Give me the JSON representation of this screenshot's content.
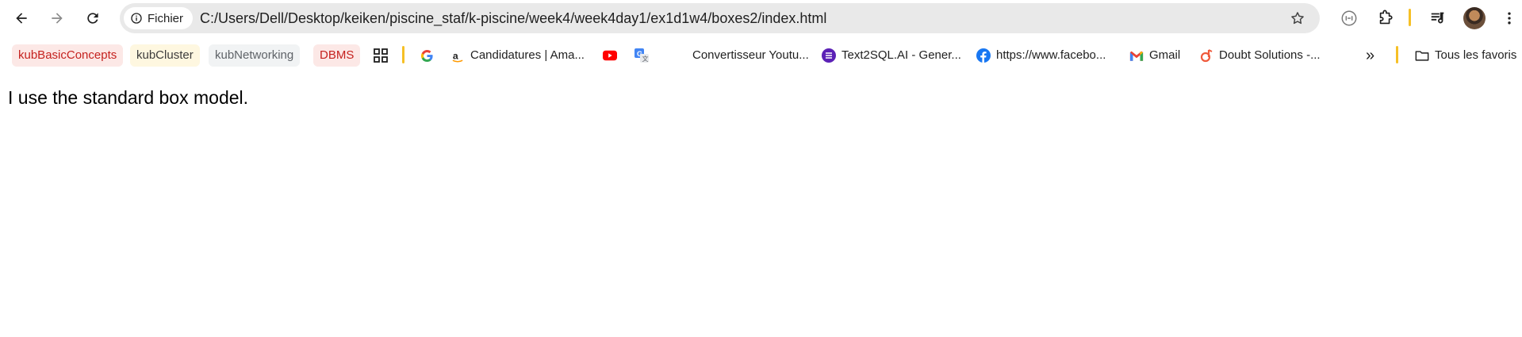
{
  "toolbar": {
    "site_chip_label": "Fichier",
    "url": "C:/Users/Dell/Desktop/keiken/piscine_staf/k-piscine/week4/week4day1/ex1d1w4/boxes2/index.html"
  },
  "bookmarks": {
    "groups": [
      {
        "label": "kubBasicConcepts",
        "color": "#c5221f",
        "bg": "#fce8e6"
      },
      {
        "label": "kubCluster",
        "color": "#3c3c3c",
        "bg": "#fef7e0"
      },
      {
        "label": "kubNetworking",
        "color": "#5f6368",
        "bg": "#f1f3f4"
      },
      {
        "label": "DBMS",
        "color": "#c5221f",
        "bg": "#fce8e6"
      }
    ],
    "items": [
      {
        "label": "Candidatures | Ama...",
        "icon": "amazon-icon"
      },
      {
        "label": "Convertisseur Youtu...",
        "icon": "blank-icon"
      },
      {
        "label": "Text2SQL.AI - Gener...",
        "icon": "text2sql-icon"
      },
      {
        "label": "https://www.facebo...",
        "icon": "facebook-icon"
      },
      {
        "label": "Gmail",
        "icon": "gmail-icon"
      },
      {
        "label": "Doubt Solutions -...",
        "icon": "doubt-solutions-icon"
      }
    ],
    "overflow_label": "»",
    "other_bookmarks_label": "Tous les favoris"
  },
  "page": {
    "text": "I use the standard box model."
  }
}
